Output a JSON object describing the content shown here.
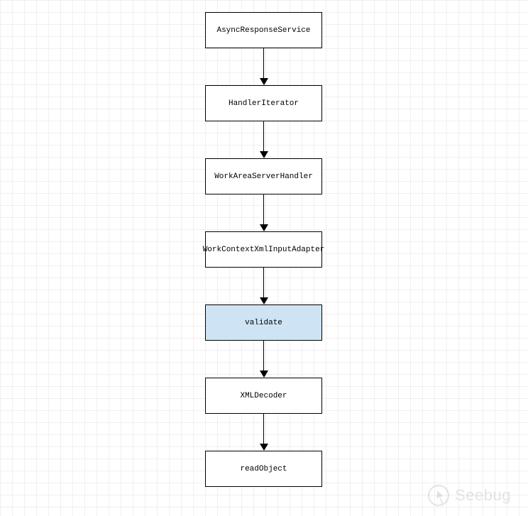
{
  "diagram": {
    "nodes": [
      {
        "label": "AsyncResponseService",
        "highlight": false
      },
      {
        "label": "HandlerIterator",
        "highlight": false
      },
      {
        "label": "WorkAreaServerHandler",
        "highlight": false
      },
      {
        "label": "WorkContextXmlInputAdapter",
        "highlight": false
      },
      {
        "label": "validate",
        "highlight": true
      },
      {
        "label": "XMLDecoder",
        "highlight": false
      },
      {
        "label": "readObject",
        "highlight": false
      }
    ]
  },
  "watermark": {
    "text": "Seebug"
  }
}
